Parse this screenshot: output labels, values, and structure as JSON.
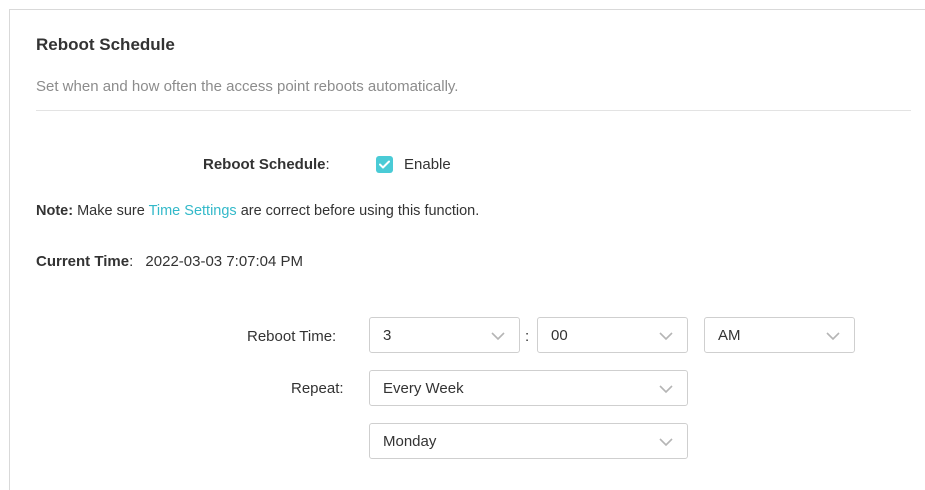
{
  "section": {
    "title": "Reboot Schedule",
    "subtitle": "Set when and how often the access point reboots automatically."
  },
  "reboot_schedule": {
    "label": "Reboot Schedule",
    "colon": ":",
    "checkbox_checked": true,
    "enable_label": "Enable"
  },
  "note": {
    "prefix": "Note:",
    "text_before": " Make sure ",
    "link": "Time Settings",
    "text_after": " are correct before using this function."
  },
  "current_time": {
    "label": "Current Time",
    "colon": ":",
    "value": "2022-03-03 7:07:04 PM"
  },
  "reboot_time": {
    "label": "Reboot Time:",
    "hour": "3",
    "separator": ":",
    "minute": "00",
    "period": "AM"
  },
  "repeat": {
    "label": "Repeat:",
    "frequency": "Every Week",
    "day": "Monday"
  },
  "colors": {
    "accent": "#4acbd6",
    "link": "#33b9c9"
  }
}
